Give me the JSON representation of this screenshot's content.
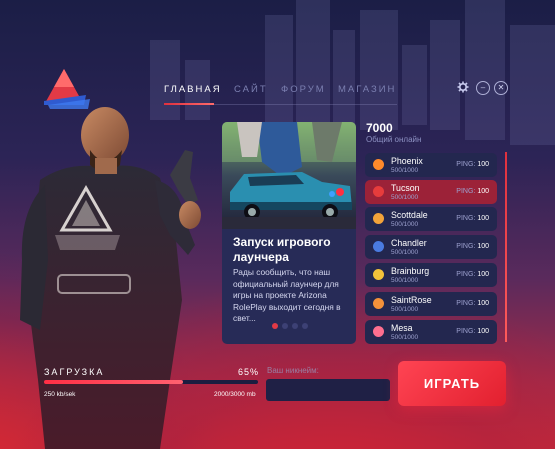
{
  "nav": {
    "items": [
      "ГЛАВНАЯ",
      "САЙТ",
      "ФОРУМ",
      "МАГАЗИН"
    ],
    "active_index": 0
  },
  "window_controls": {
    "settings_icon": "gear-icon",
    "minimize_icon": "minimize-icon",
    "close_icon": "close-icon",
    "minimize_symbol": "–",
    "close_symbol": "✕"
  },
  "news": {
    "title": "Запуск игрового лаунчера",
    "text": "Рады сообщить, что наш официальный лаунчер для игры на проекте Arizona RolePlay выходит сегодня в свет...",
    "dots_count": 4,
    "active_dot": 0
  },
  "online": {
    "count": "7000",
    "label": "Общий онлайн"
  },
  "servers": [
    {
      "name": "Phoenix",
      "slots": "500/1000",
      "ping_label": "PING:",
      "ping": "100",
      "icon_color": "#ff8a2b",
      "selected": false
    },
    {
      "name": "Tucson",
      "slots": "500/1000",
      "ping_label": "PING:",
      "ping": "100",
      "icon_color": "#e73c3c",
      "selected": true
    },
    {
      "name": "Scottdale",
      "slots": "500/1000",
      "ping_label": "PING:",
      "ping": "100",
      "icon_color": "#f2a33a",
      "selected": false
    },
    {
      "name": "Chandler",
      "slots": "500/1000",
      "ping_label": "PING:",
      "ping": "100",
      "icon_color": "#4a7be0",
      "selected": false
    },
    {
      "name": "Brainburg",
      "slots": "500/1000",
      "ping_label": "PING:",
      "ping": "100",
      "icon_color": "#f2c23a",
      "selected": false
    },
    {
      "name": "SaintRose",
      "slots": "500/1000",
      "ping_label": "PING:",
      "ping": "100",
      "icon_color": "#f4913a",
      "selected": false
    },
    {
      "name": "Mesa",
      "slots": "500/1000",
      "ping_label": "PING:",
      "ping": "100",
      "icon_color": "#ff6f8f",
      "selected": false
    }
  ],
  "download": {
    "label": "ЗАГРУЗКА",
    "percent": "65%",
    "progress": 0.65,
    "speed": "250 kb/sek",
    "size": "2000/3000 mb"
  },
  "nickname": {
    "label": "Ваш никнейм:",
    "value": "",
    "placeholder": ""
  },
  "play_button": {
    "label": "ИГРАТЬ"
  },
  "colors": {
    "accent": "#e82a3c",
    "panel": "#23274f",
    "selected_server": "#9c2238"
  }
}
